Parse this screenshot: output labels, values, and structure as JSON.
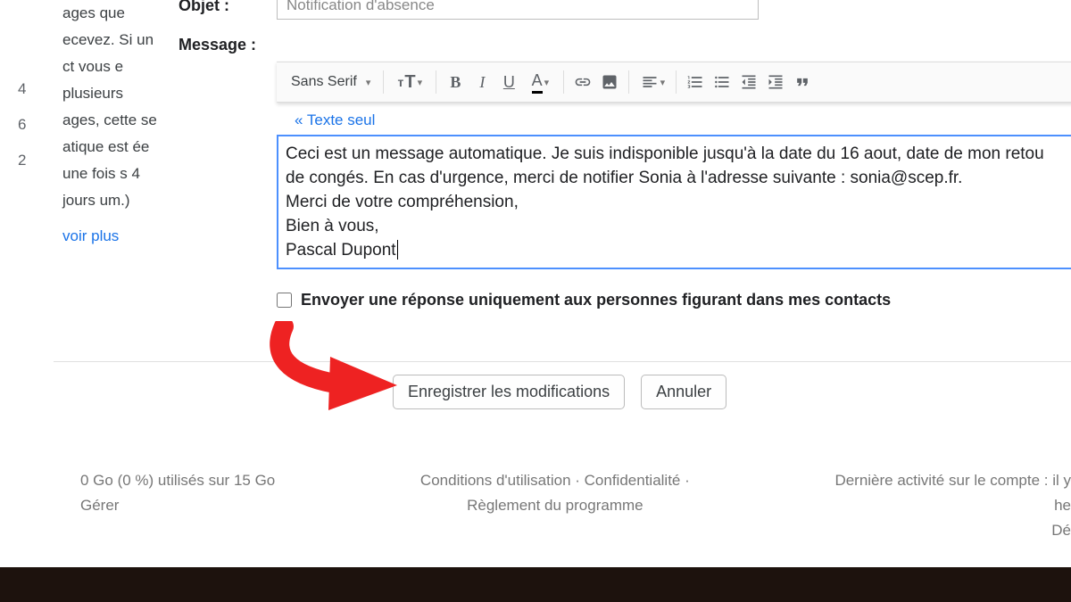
{
  "left": {
    "numbers": [
      "4",
      "6",
      "2"
    ],
    "text": "ages que ecevez. Si un ct vous e plusieurs ages, cette se atique est ée une fois s 4 jours um.)",
    "seeMore": "voir plus"
  },
  "form": {
    "subjectLabel": "Objet :",
    "subjectValue": "Notification d'absence",
    "messageLabel": "Message :",
    "font": "Sans Serif",
    "plaintextLink": "« Texte seul",
    "body": {
      "l1": "Ceci est un message automatique. Je suis indisponible jusqu'à la date du 16 aout, date de mon retou",
      "l2": "de congés. En cas d'urgence, merci de notifier Sonia à l'adresse suivante : sonia@scep.fr.",
      "l3": "Merci de votre compréhension,",
      "l4": "Bien à vous,",
      "l5": "Pascal Dupont"
    },
    "checkboxLabel": "Envoyer une réponse uniquement aux personnes figurant dans mes contacts",
    "save": "Enregistrer les modifications",
    "cancel": "Annuler"
  },
  "footer": {
    "storage": "0 Go (0 %) utilisés sur 15 Go",
    "manage": "Gérer",
    "terms": "Conditions d'utilisation · Confidentialité ·",
    "policy": "Règlement du programme",
    "activity": "Dernière activité sur le compte : il y",
    "activity2": "he",
    "activity3": "Dé"
  }
}
